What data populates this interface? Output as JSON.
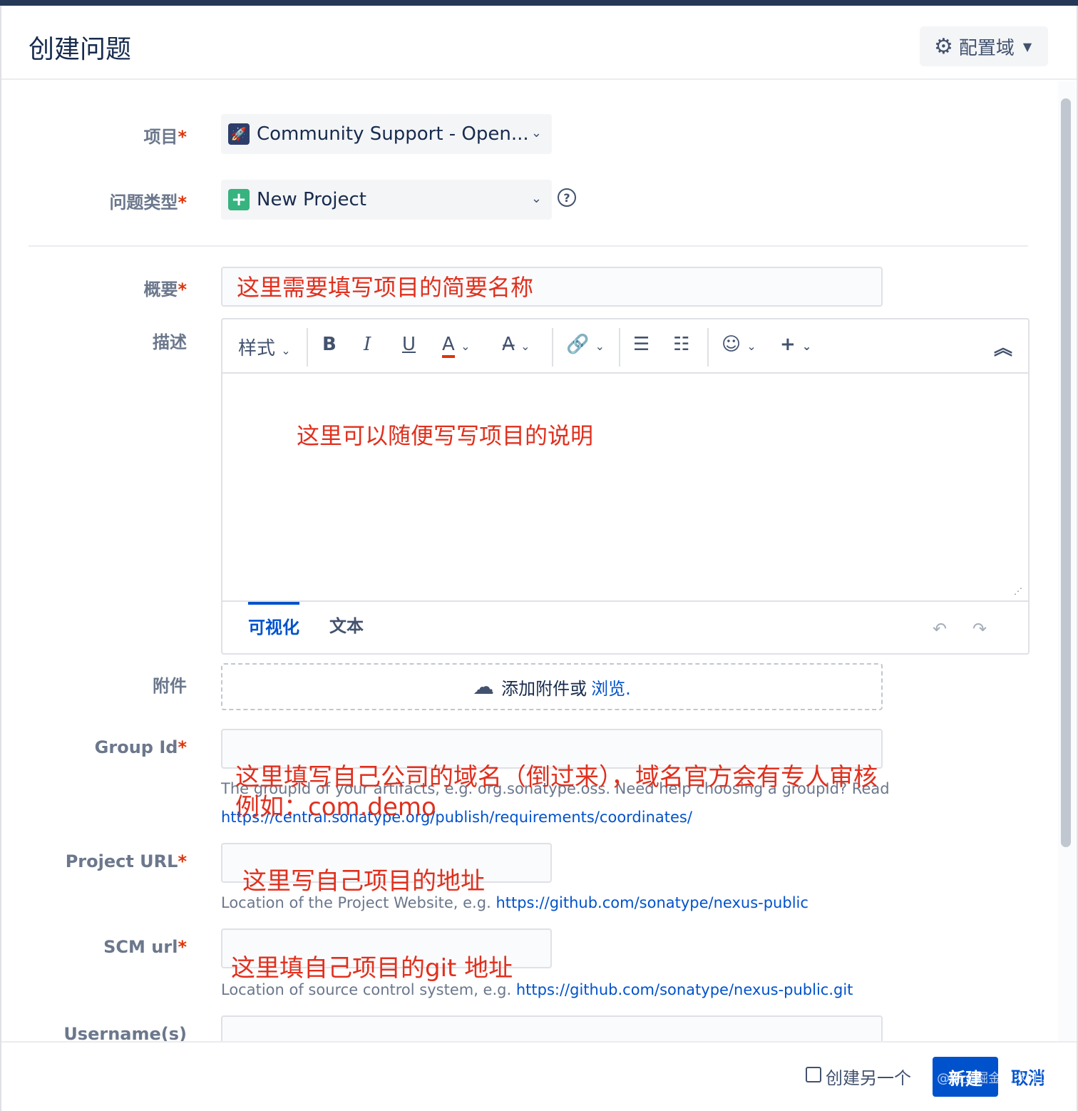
{
  "header": {
    "title": "创建问题",
    "config_label": "配置域"
  },
  "fields": {
    "project": {
      "label": "项目",
      "required": "*",
      "value": "Community Support - Open..."
    },
    "issue_type": {
      "label": "问题类型",
      "required": "*",
      "value": "New Project"
    },
    "summary": {
      "label": "概要",
      "required": "*"
    },
    "description": {
      "label": "描述"
    },
    "attachment": {
      "label": "附件",
      "text": "添加附件或",
      "browse": "浏览."
    },
    "group_id": {
      "label": "Group Id",
      "required": "*",
      "hint": "The groupId of your artifacts, e.g. org.sonatype.oss. Need help choosing a groupId? Read",
      "hint_link": "https://central.sonatype.org/publish/requirements/coordinates/"
    },
    "project_url": {
      "label": "Project URL",
      "required": "*",
      "hint": "Location of the Project Website, e.g.",
      "hint_link": "https://github.com/sonatype/nexus-public"
    },
    "scm_url": {
      "label": "SCM url",
      "required": "*",
      "hint": "Location of source control system, e.g.",
      "hint_link": "https://github.com/sonatype/nexus-public.git"
    },
    "usernames": {
      "label": "Username(s)"
    }
  },
  "toolbar": {
    "style": "样式",
    "bold": "B",
    "italic": "I",
    "underline": "U",
    "color": "A",
    "tab_visual": "可视化",
    "tab_text": "文本"
  },
  "annotations": {
    "summary": "这里需要填写项目的简要名称",
    "description": "这里可以随便写写项目的说明",
    "group_id_1": "这里填写自己公司的域名（倒过来），域名官方会有专人审核",
    "group_id_2": "例如：com.demo",
    "project_url": "这里写自己项目的地址",
    "scm_url": "这里填自己项目的git 地址"
  },
  "footer": {
    "create_another": "创建另一个",
    "create": "新建",
    "cancel": "取消",
    "watermark": "@稀土掘金技术社区"
  },
  "colors": {
    "primary": "#0052cc",
    "annotation": "#e0301e",
    "required": "#de350b"
  }
}
